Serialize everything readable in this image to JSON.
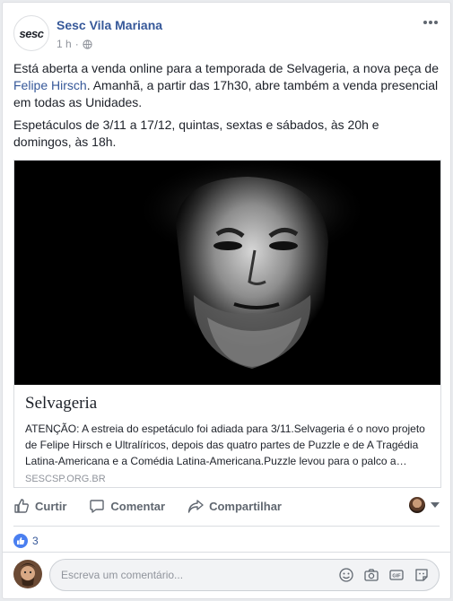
{
  "post": {
    "page_name": "Sesc Vila Mariana",
    "avatar_text": "sesc",
    "timestamp": "1 h",
    "meta_separator": "·",
    "paragraph1_before_link": "Está aberta a venda online para a temporada de Selvageria, a nova peça de ",
    "paragraph1_link": "Felipe Hirsch",
    "paragraph1_after_link": ". Amanhã, a partir das 17h30, abre também a venda presencial em todas as Unidades.",
    "paragraph2": "Espetáculos de 3/11 a 17/12, quintas, sextas e sábados, às 20h e domingos, às 18h."
  },
  "link_preview": {
    "title": "Selvageria",
    "description": "ATENÇÃO: A estreia do espetáculo foi adiada para 3/11.Selvageria é o novo projeto de Felipe Hirsch e Ultralíricos, depois das quatro partes de Puzzle e de A Tragédia Latina-Americana e a Comédia Latina-Americana.Puzzle levou para o palco a…",
    "domain": "SESCSP.ORG.BR"
  },
  "actions": {
    "like": "Curtir",
    "comment": "Comentar",
    "share": "Compartilhar"
  },
  "reactions": {
    "count": "3"
  },
  "comment": {
    "placeholder": "Escreva um comentário..."
  },
  "colors": {
    "link": "#365899",
    "like_blue": "#4a7ff0",
    "muted": "#90949c"
  },
  "icons": [
    "globe-icon",
    "more-options-icon",
    "like-icon",
    "comment-icon",
    "share-icon",
    "caret-down-icon",
    "emoji-icon",
    "camera-icon",
    "gif-icon",
    "sticker-icon"
  ]
}
